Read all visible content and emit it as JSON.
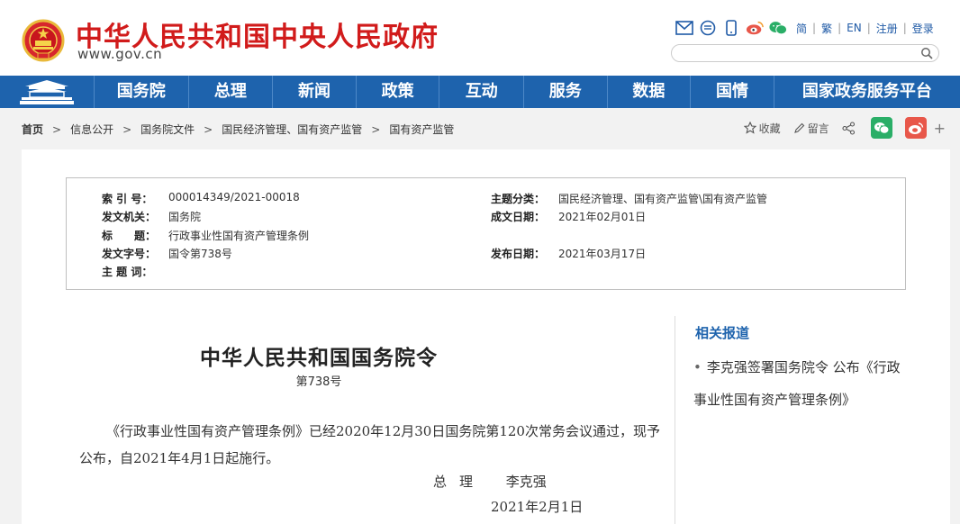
{
  "header": {
    "site_title": "中华人民共和国中央人民政府",
    "domain": "www.gov.cn",
    "lang_links": [
      "简",
      "繁",
      "EN",
      "注册",
      "登录"
    ],
    "search_placeholder": ""
  },
  "nav": {
    "items": [
      "国务院",
      "总理",
      "新闻",
      "政策",
      "互动",
      "服务",
      "数据",
      "国情",
      "国家政务服务平台"
    ]
  },
  "breadcrumb": {
    "items": [
      "首页",
      "信息公开",
      "国务院文件",
      "国民经济管理、国有资产监管",
      "国有资产监管"
    ]
  },
  "actions": {
    "favorite": "收藏",
    "comment": "留言"
  },
  "meta": {
    "index_label": "索 引 号：",
    "index_value": "000014349/2021-00018",
    "category_label": "主题分类：",
    "category_value": "国民经济管理、国有资产监管\\国有资产监管",
    "issuer_label": "发文机关：",
    "issuer_value": "国务院",
    "created_label": "成文日期：",
    "created_value": "2021年02月01日",
    "title_label": "标　　题：",
    "title_value": "行政事业性国有资产管理条例",
    "docno_label": "发文字号：",
    "docno_value": "国令第738号",
    "published_label": "发布日期：",
    "published_value": "2021年03月17日",
    "keywords_label": "主 题 词："
  },
  "document": {
    "title": "中华人民共和国国务院令",
    "number": "第738号",
    "body": "《行政事业性国有资产管理条例》已经2020年12月30日国务院第120次常务会议通过，现予公布，自2021年4月1日起施行。",
    "sign_role": "总理",
    "sign_name": "李克强",
    "date": "2021年2月1日"
  },
  "related": {
    "title": "相关报道",
    "items": [
      "李克强签署国务院令 公布《行政事业性国有资产管理条例》"
    ]
  },
  "colors": {
    "brand_red": "#d11b1b",
    "nav_blue": "#1e63ad",
    "wechat_green": "#2aae67",
    "weibo_red": "#e8574a"
  }
}
